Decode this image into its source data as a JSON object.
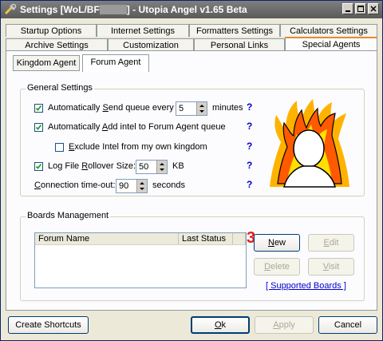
{
  "window": {
    "title_prefix": "Settings [WoL/BF",
    "title_suffix": "] - Utopia Angel v1.65 Beta"
  },
  "tabs_row1": [
    {
      "label": "Startup Options"
    },
    {
      "label": "Internet Settings"
    },
    {
      "label": "Formatters Settings"
    },
    {
      "label": "Calculators Settings"
    }
  ],
  "tabs_row2": [
    {
      "label": "Archive Settings"
    },
    {
      "label": "Customization"
    },
    {
      "label": "Personal Links"
    },
    {
      "label": "Special Agents"
    }
  ],
  "subtabs": [
    {
      "label": "Kingdom Agent"
    },
    {
      "label": "Forum Agent"
    }
  ],
  "general": {
    "title": "General Settings",
    "send_queue": {
      "pre": "Automatically ",
      "u": "S",
      "post": "end queue every",
      "value": "5",
      "unit": "minutes",
      "checked": true
    },
    "add_intel": {
      "pre": "Automatically ",
      "u": "A",
      "post": "dd intel to Forum Agent queue",
      "checked": true
    },
    "exclude_intel": {
      "pre": "",
      "u": "E",
      "post": "xclude Intel from my own kingdom",
      "checked": false
    },
    "log_rollover": {
      "pre": "Log File ",
      "u": "R",
      "post": "ollover Size:",
      "value": "50",
      "unit": "KB",
      "checked": true
    },
    "timeout": {
      "pre": "",
      "u": "C",
      "post": "onnection time-out:",
      "value": "90",
      "unit": "seconds"
    },
    "help": "?"
  },
  "boards": {
    "title": "Boards Management",
    "columns": [
      "Forum Name",
      "Last Status"
    ],
    "new_u": "N",
    "new_rest": "ew",
    "edit_u": "E",
    "edit_rest": "dit",
    "delete_u": "D",
    "delete_rest": "elete",
    "visit_u": "V",
    "visit_rest": "isit",
    "supported": "[ Supported Boards ]",
    "annotation": "3."
  },
  "footer": {
    "shortcuts": "Create Shortcuts",
    "ok_u": "O",
    "ok_rest": "k",
    "apply_u": "A",
    "apply_rest": "pply",
    "cancel": "Cancel"
  },
  "colors": {
    "help": "#0000cc",
    "annotation": "#e0201a",
    "active_tab_accent": "#e68b2c"
  }
}
